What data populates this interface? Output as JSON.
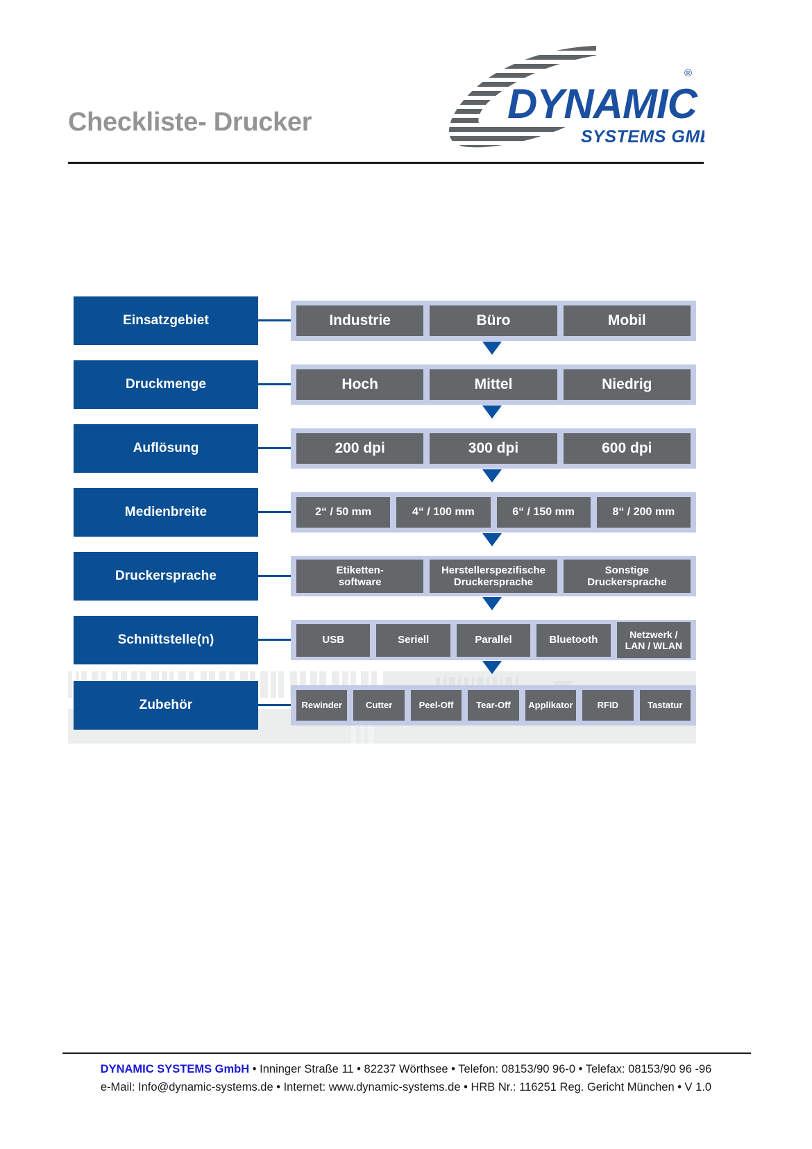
{
  "header": {
    "title": "Checkliste- Drucker",
    "logo": {
      "wordmark": "DYNAMIC",
      "tagline": "SYSTEMS GMBH",
      "registered_mark": "®"
    }
  },
  "colors": {
    "label_blue": "#0a4e93",
    "band_light_blue": "#c3cbe7",
    "option_gray": "#63676a",
    "arrow_blue": "#0a51a2",
    "title_gray": "#949494",
    "footer_brand_blue": "#1919d6"
  },
  "diagram": {
    "rows": [
      {
        "label": "Einsatzgebiet",
        "options": [
          "Industrie",
          "Büro",
          "Mobil"
        ]
      },
      {
        "label": "Druckmenge",
        "options": [
          "Hoch",
          "Mittel",
          "Niedrig"
        ]
      },
      {
        "label": "Auflösung",
        "options": [
          "200 dpi",
          "300 dpi",
          "600 dpi"
        ]
      },
      {
        "label": "Medienbreite",
        "options": [
          "2“ / 50 mm",
          "4“ / 100 mm",
          "6“ / 150 mm",
          "8“ / 200 mm"
        ]
      },
      {
        "label": "Druckersprache",
        "options": [
          "Etiketten-\nsoftware",
          "Herstellerspezifische\nDruckersprache",
          "Sonstige\nDruckersprache"
        ]
      },
      {
        "label": "Schnittstelle(n)",
        "options": [
          "USB",
          "Seriell",
          "Parallel",
          "Bluetooth",
          "Netzwerk /\nLAN / WLAN"
        ]
      },
      {
        "label": "Zubehör",
        "options": [
          "Rewinder",
          "Cutter",
          "Peel-Off",
          "Tear-Off",
          "Applikator",
          "RFID",
          "Tastatur"
        ]
      }
    ]
  },
  "footer": {
    "company": "DYNAMIC SYSTEMS GmbH",
    "line1_rest": " • Inninger Straße 11 • 82237 Wörthsee • Telefon: 08153/90 96-0 • Telefax: 08153/90 96 -96",
    "line2": "e-Mail: Info@dynamic-systems.de • Internet: www.dynamic-systems.de • HRB Nr.: 116251 Reg. Gericht München • V 1.0"
  }
}
